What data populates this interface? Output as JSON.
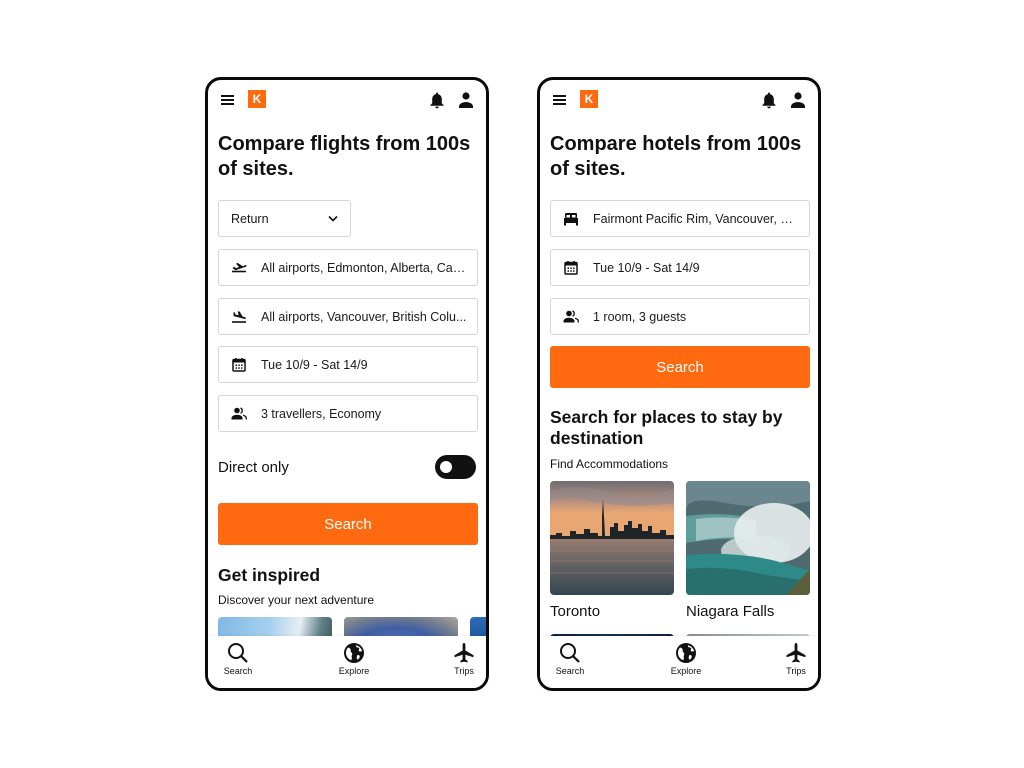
{
  "brand": {
    "logo_letter": "K",
    "accent": "#ff690f"
  },
  "flights_screen": {
    "header": {
      "menu_icon": "hamburger-icon",
      "notifications_icon": "bell-icon",
      "profile_icon": "user-icon"
    },
    "headline": "Compare flights from 100s of sites.",
    "trip_type": {
      "selected": "Return"
    },
    "fields": [
      {
        "icon": "takeoff-icon",
        "value": "All airports, Edmonton, Alberta, Can..."
      },
      {
        "icon": "landing-icon",
        "value": "All airports, Vancouver, British Colu..."
      },
      {
        "icon": "calendar-icon",
        "value": "Tue 10/9 - Sat 14/9"
      },
      {
        "icon": "travellers-icon",
        "value": "3 travellers, Economy"
      }
    ],
    "direct_only": {
      "label": "Direct only",
      "enabled": false
    },
    "search_label": "Search",
    "inspired": {
      "title": "Get inspired",
      "subtitle": "Discover your next adventure"
    },
    "nav": [
      {
        "icon": "search-icon",
        "label": "Search"
      },
      {
        "icon": "globe-icon",
        "label": "Explore"
      },
      {
        "icon": "plane-icon",
        "label": "Trips"
      }
    ]
  },
  "hotels_screen": {
    "header": {
      "menu_icon": "hamburger-icon",
      "notifications_icon": "bell-icon",
      "profile_icon": "user-icon"
    },
    "headline": "Compare hotels from 100s of sites.",
    "fields": [
      {
        "icon": "bed-icon",
        "value": "Fairmont Pacific Rim, Vancouver, Bri..."
      },
      {
        "icon": "calendar-icon",
        "value": "Tue 10/9 - Sat 14/9"
      },
      {
        "icon": "guests-icon",
        "value": "1 room, 3 guests"
      }
    ],
    "search_label": "Search",
    "destinations": {
      "title": "Search for places to stay by destination",
      "subtitle": "Find Accommodations",
      "items": [
        {
          "name": "Toronto"
        },
        {
          "name": "Niagara Falls"
        }
      ]
    },
    "nav": [
      {
        "icon": "search-icon",
        "label": "Search"
      },
      {
        "icon": "globe-icon",
        "label": "Explore"
      },
      {
        "icon": "plane-icon",
        "label": "Trips"
      }
    ]
  }
}
